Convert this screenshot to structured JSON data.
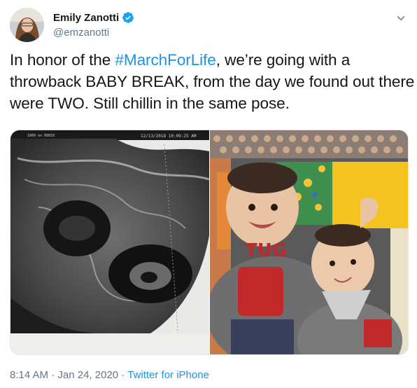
{
  "author": {
    "display_name": "Emily Zanotti",
    "handle": "@emzanotti",
    "verified": true
  },
  "tweet": {
    "lines": [
      {
        "prefix": "In honor of the ",
        "hashtag": "#MarchForLife",
        "suffix": ", we’re going with a"
      },
      {
        "text": "throwback BABY BREAK, from the day we found out there"
      },
      {
        "text": "were TWO.  Still chillin in the same pose."
      }
    ]
  },
  "media": {
    "left_image": {
      "description_icon": "ultrasound-image",
      "overlay_text": "12/13/2018   10:09:25 AM",
      "corner_text": "1000 on 00810"
    },
    "right_image": {
      "description_icon": "twin-babies-photo",
      "shirt_text": "TUG"
    }
  },
  "meta": {
    "time": "8:14 AM",
    "separator": " · ",
    "date": "Jan 24, 2020",
    "source": "Twitter for iPhone"
  },
  "colors": {
    "link": "#1b95e0",
    "secondary": "#657786",
    "verified": "#1da1f2"
  },
  "icons": {
    "verified": "verified-badge-icon",
    "menu": "chevron-down-icon"
  }
}
